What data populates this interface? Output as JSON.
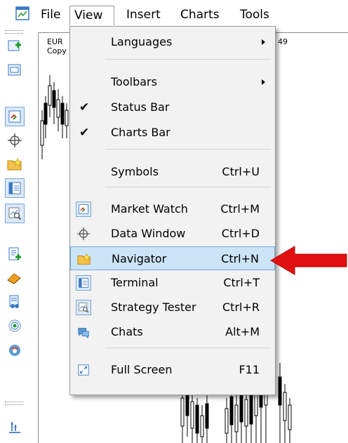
{
  "menubar": {
    "items": [
      "File",
      "View",
      "Insert",
      "Charts",
      "Tools"
    ]
  },
  "chart": {
    "symbol": "EUR",
    "subtitle": "Copy",
    "price_fragment": "49"
  },
  "dropdown": {
    "items": [
      {
        "label": "Languages",
        "shortcut": "",
        "submenu": true
      },
      {
        "label": "Toolbars",
        "shortcut": "",
        "submenu": true
      },
      {
        "label": "Status Bar",
        "shortcut": "",
        "checked": true
      },
      {
        "label": "Charts Bar",
        "shortcut": "",
        "checked": true
      },
      {
        "label": "Symbols",
        "shortcut": "Ctrl+U"
      },
      {
        "label": "Market Watch",
        "shortcut": "Ctrl+M",
        "icon": "market-watch-icon"
      },
      {
        "label": "Data Window",
        "shortcut": "Ctrl+D",
        "icon": "crosshair-icon"
      },
      {
        "label": "Navigator",
        "shortcut": "Ctrl+N",
        "icon": "navigator-folder-icon",
        "highlighted": true
      },
      {
        "label": "Terminal",
        "shortcut": "Ctrl+T",
        "icon": "terminal-icon"
      },
      {
        "label": "Strategy Tester",
        "shortcut": "Ctrl+R",
        "icon": "strategy-tester-icon"
      },
      {
        "label": "Chats",
        "shortcut": "Alt+M",
        "icon": "chats-icon"
      },
      {
        "label": "Full Screen",
        "shortcut": "F11",
        "icon": "full-screen-icon"
      }
    ]
  },
  "colors": {
    "highlight": "#cce4f7",
    "highlight_border": "#6fa7db",
    "pointer_arrow": "#e01010"
  }
}
